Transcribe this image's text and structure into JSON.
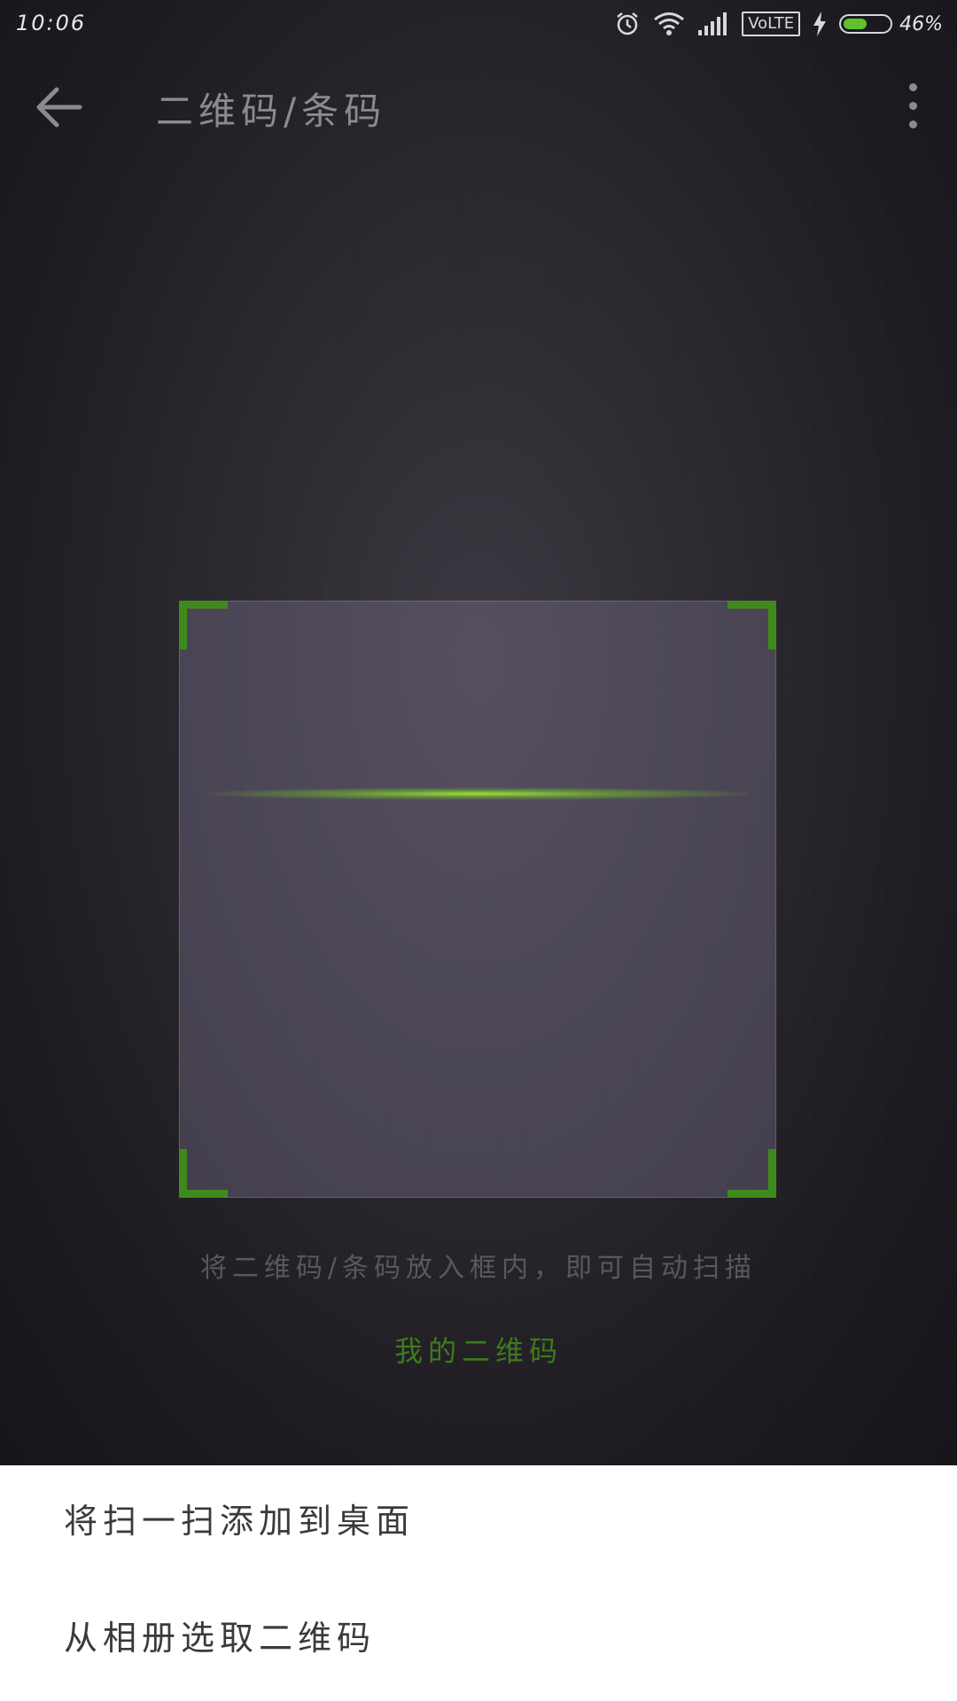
{
  "status_bar": {
    "time": "10:06",
    "network_label": "VoLTE",
    "battery_percent_text": "46%",
    "battery_level": 0.46,
    "icons": [
      "alarm-icon",
      "wifi-icon",
      "signal-icon",
      "charging-icon",
      "battery-icon"
    ]
  },
  "app_bar": {
    "title": "二维码/条码",
    "back_icon": "arrow-left-icon",
    "more_icon": "more-vertical-icon"
  },
  "scanner": {
    "hint": "将二维码/条码放入框内，即可自动扫描",
    "my_qr_label": "我的二维码",
    "accent_color": "#3f8a1c"
  },
  "menu": {
    "items": [
      {
        "label": "将扫一扫添加到桌面"
      },
      {
        "label": "从相册选取二维码"
      }
    ]
  }
}
